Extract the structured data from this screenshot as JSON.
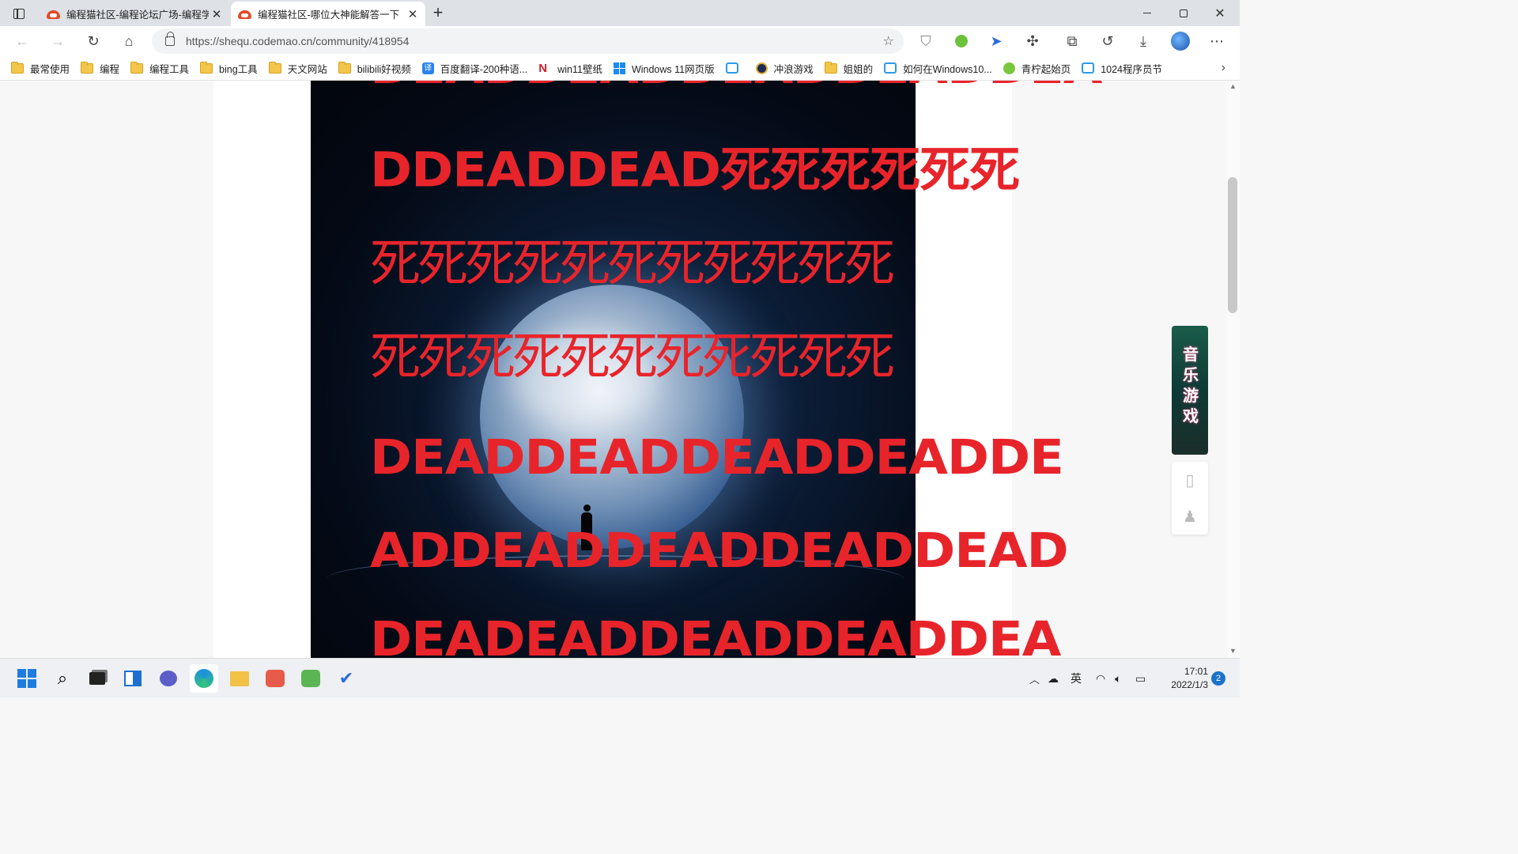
{
  "browser": {
    "tabs": [
      {
        "title": "编程猫社区-编程论坛广场-编程学"
      },
      {
        "title": "编程猫社区-哪位大神能解答一下"
      }
    ],
    "new_tab": "+",
    "url": "https://shequ.codemao.cn/community/418954"
  },
  "bookmarks": [
    {
      "label": "最常使用",
      "icon": "folder-icon"
    },
    {
      "label": "编程",
      "icon": "folder-icon"
    },
    {
      "label": "编程工具",
      "icon": "folder-icon"
    },
    {
      "label": "bing工具",
      "icon": "folder-icon"
    },
    {
      "label": "天文网站",
      "icon": "folder-icon"
    },
    {
      "label": "bilibili好视频",
      "icon": "folder-icon"
    },
    {
      "label": "百度翻译-200种语...",
      "icon": "translate-icon"
    },
    {
      "label": "win11壁纸",
      "icon": "n-logo-icon"
    },
    {
      "label": "Windows 11网页版",
      "icon": "windows-icon"
    },
    {
      "label": "",
      "icon": "bilibili-icon"
    },
    {
      "label": "冲浪游戏",
      "icon": "surf-game-icon"
    },
    {
      "label": "姐姐的",
      "icon": "folder-icon"
    },
    {
      "label": "如何在Windows10...",
      "icon": "bilibili-icon"
    },
    {
      "label": "青柠起始页",
      "icon": "lemon-icon"
    },
    {
      "label": "1024程序员节",
      "icon": "bilibili-icon"
    }
  ],
  "poster": {
    "lines": [
      {
        "text": "DEADDEADDEADDEADDEA",
        "kind": "en"
      },
      {
        "text": "DDEADDEAD死死死死死死",
        "kind": "mixed"
      },
      {
        "text": "死死死死死死死死死死死",
        "kind": "cn"
      },
      {
        "text": "死死死死死死死死死死死",
        "kind": "cn"
      },
      {
        "text": "DEADDEADDEADDEADDE",
        "kind": "en"
      },
      {
        "text": "ADDEADDEADDEADDEAD",
        "kind": "en"
      },
      {
        "text": "DEADEADDEADDEADDEA",
        "kind": "en"
      }
    ],
    "text_color": "#e8242b"
  },
  "side_ad": {
    "text": "音乐游戏"
  },
  "taskbar": {
    "tray_ime": "英",
    "time": "17:01",
    "date": "2022/1/3",
    "notifications": "2"
  }
}
